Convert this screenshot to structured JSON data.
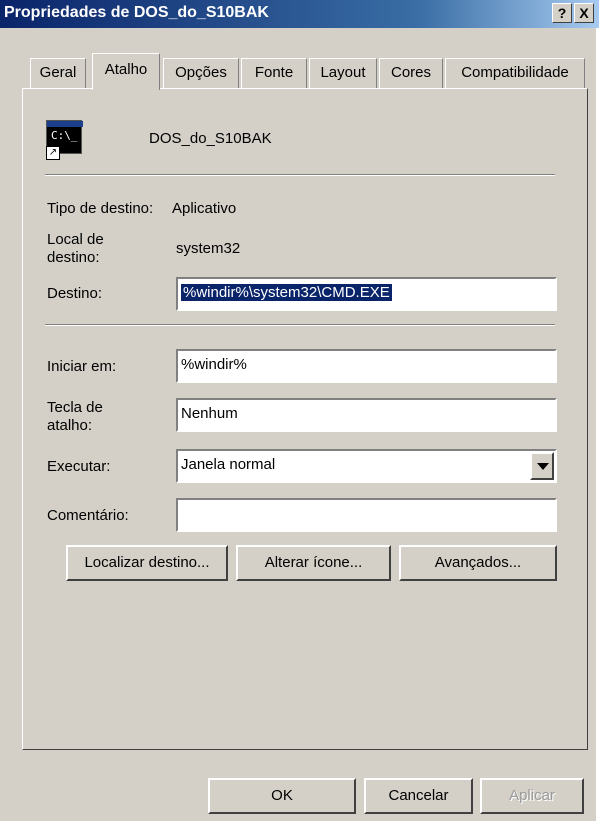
{
  "window": {
    "title": "Propriedades de DOS_do_S10BAK",
    "help_btn": "?",
    "close_btn": "X"
  },
  "tabs": [
    "Geral",
    "Atalho",
    "Opções",
    "Fonte",
    "Layout",
    "Cores",
    "Compatibilidade"
  ],
  "active_tab": "Atalho",
  "shortcut": {
    "icon": "cmd-shortcut-icon",
    "icon_text": "C:\\_",
    "name": "DOS_do_S10BAK",
    "target_type_label": "Tipo de destino:",
    "target_type_value": "Aplicativo",
    "target_location_label_1": "Local de",
    "target_location_label_2": "destino:",
    "target_location_value": "system32",
    "target_label": "Destino:",
    "target_value": "%windir%\\system32\\CMD.EXE",
    "start_in_label": "Iniciar em:",
    "start_in_value": "%windir%",
    "hotkey_label_1": "Tecla de",
    "hotkey_label_2": "atalho:",
    "hotkey_value": "Nenhum",
    "run_label": "Executar:",
    "run_value": "Janela normal",
    "comment_label": "Comentário:",
    "comment_value": ""
  },
  "buttons": {
    "find_target": "Localizar destino...",
    "change_icon": "Alterar ícone...",
    "advanced": "Avançados...",
    "ok": "OK",
    "cancel": "Cancelar",
    "apply": "Aplicar"
  }
}
